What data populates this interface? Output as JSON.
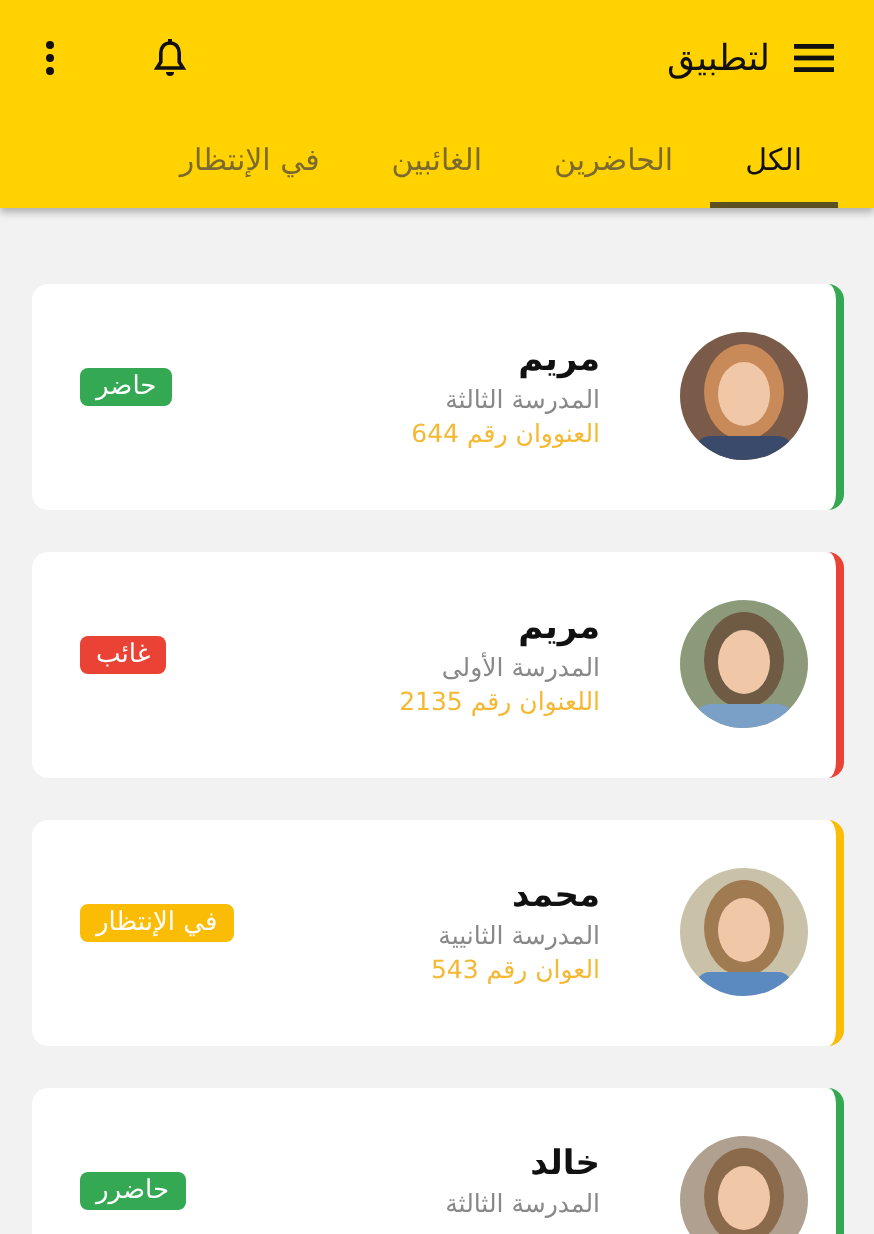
{
  "app_bar": {
    "title": "لتطبيق"
  },
  "tabs": [
    {
      "label": "الكل",
      "selected": true
    },
    {
      "label": "الحاضرين",
      "selected": false
    },
    {
      "label": "الغائبين",
      "selected": false
    },
    {
      "label": "في الإنتظار",
      "selected": false
    }
  ],
  "students": [
    {
      "name": "مريم",
      "school": "المدرسة الثالثة",
      "address": "العنووان رقم 644",
      "status": "حاضر",
      "color": "#34a853"
    },
    {
      "name": "مريم",
      "school": "المدرسة الأولى",
      "address": "اللعنوان رقم 2135",
      "status": "غائب",
      "color": "#ea4335"
    },
    {
      "name": "محمد",
      "school": "المدرسة الثانيية",
      "address": "العوان رقم 543",
      "status": "في الإنتظار",
      "color": "#fbbc05"
    },
    {
      "name": "خالد",
      "school": "المدرسة الثالثة",
      "status": "حاضرر",
      "color": "#34a853"
    }
  ]
}
